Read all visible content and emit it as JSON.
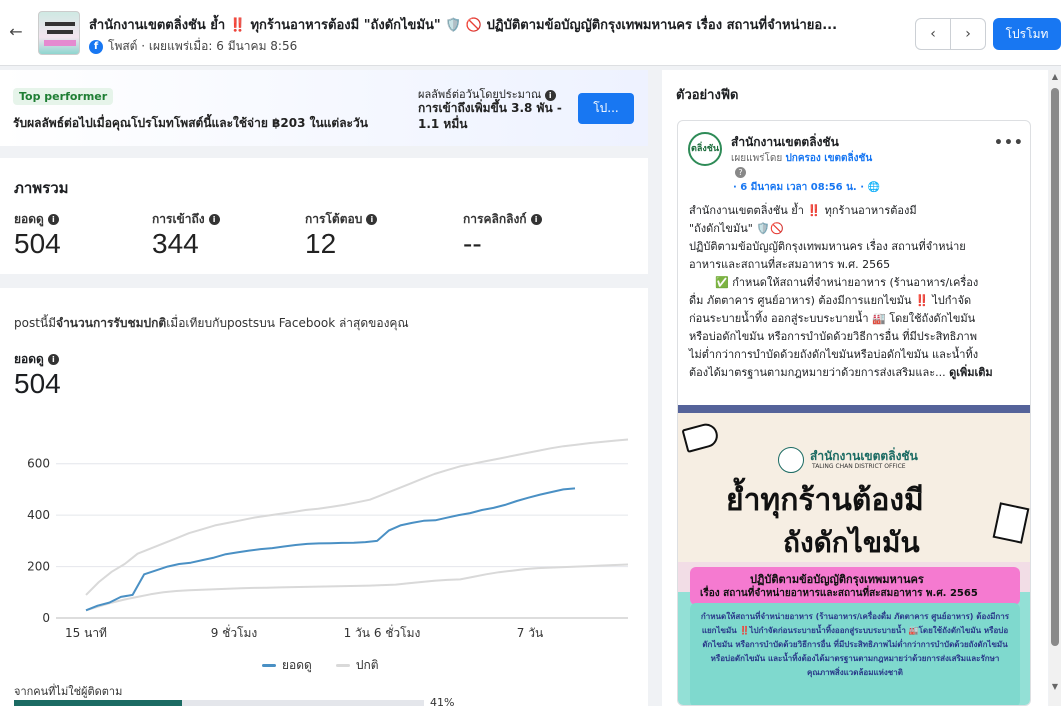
{
  "header": {
    "title": "สำนักงานเขตตลิ่งชัน ย้ำ ‼️ ทุกร้านอาหารต้องมี \"ถังดักไขมัน\" 🛡️ 🚫 ปฏิบัติตามข้อบัญญัติกรุงเทพมหานคร เรื่อง สถานที่จำหน่ายอ...",
    "meta": "โพสต์ · เผยแพร่เมื่อ: 6 มีนาคม 8:56",
    "promote_label": "โปรโมท",
    "back_icon": "←",
    "prev_icon": "‹",
    "next_icon": "›"
  },
  "top_performer": {
    "badge": "Top performer",
    "text": "รับผลลัพธ์ต่อไปเมื่อคุณโปรโมทโพสต์นี้และใช้จ่าย ฿203 ในแต่ละวัน",
    "result_label": "ผลลัพธ์ต่อวันโดยประมาณ",
    "result_value": "การเข้าถึงเพิ่มขึ้น 3.8 พัน - 1.1 หมื่น",
    "button_label": "โป..."
  },
  "overview": {
    "title": "ภาพรวม",
    "metrics": [
      {
        "label": "ยอดดู",
        "value": "504"
      },
      {
        "label": "การเข้าถึง",
        "value": "344"
      },
      {
        "label": "การโต้ตอบ",
        "value": "12"
      },
      {
        "label": "การคลิกลิงก์",
        "value": "--"
      }
    ]
  },
  "chart_panel": {
    "desc_pre": "postนี้มี",
    "desc_bold": "จำนวนการรับชมปกติ",
    "desc_post": "เมื่อเทียบกับpostsบน Facebook ล่าสุดของคุณ",
    "metric_label": "ยอดดู",
    "metric_value": "504",
    "non_follower_label": "จากคนที่ไม่ใช่ผู้ติดตาม",
    "non_follower_pct": "41%",
    "non_follower_fraction": 0.41
  },
  "chart_data": {
    "type": "line",
    "x_ticks": [
      "15 นาที",
      "9 ชั่วโมง",
      "1 วัน 6 ชั่วโมง",
      "7 วัน"
    ],
    "y_ticks": [
      0,
      200,
      400,
      600
    ],
    "ylim": [
      0,
      700
    ],
    "legend_position": "bottom",
    "series": [
      {
        "name": "ยอดดู",
        "color": "#4a90c4",
        "values": [
          30,
          48,
          60,
          82,
          90,
          170,
          185,
          200,
          210,
          215,
          225,
          235,
          248,
          255,
          262,
          268,
          272,
          278,
          284,
          288,
          290,
          291,
          292,
          293,
          295,
          300,
          340,
          360,
          370,
          378,
          380,
          390,
          400,
          408,
          420,
          428,
          440,
          455,
          468,
          480,
          490,
          500,
          504
        ]
      },
      {
        "name": "ปกติ",
        "color": "#d9d9d9",
        "values": [
          90,
          140,
          180,
          210,
          250,
          270,
          290,
          310,
          330,
          345,
          360,
          370,
          380,
          390,
          398,
          405,
          412,
          420,
          425,
          432,
          440,
          450,
          460,
          480,
          500,
          520,
          540,
          560,
          575,
          590,
          600,
          610,
          620,
          630,
          640,
          650,
          660,
          668,
          674,
          680,
          685,
          690,
          694
        ]
      },
      {
        "name": "",
        "color": "#d9d9d9",
        "values": [
          30,
          45,
          60,
          72,
          82,
          92,
          100,
          105,
          108,
          110,
          112,
          114,
          116,
          117,
          118,
          119,
          120,
          121,
          122,
          123,
          124,
          125,
          126,
          128,
          130,
          135,
          140,
          145,
          148,
          150,
          160,
          170,
          178,
          184,
          190,
          194,
          196,
          198,
          200,
          202,
          204,
          206,
          208
        ]
      }
    ]
  },
  "preview": {
    "title": "ตัวอย่างฟีด",
    "page_name": "สำนักงานเขตตลิ่งชัน",
    "avatar_text": "ตลิ่งชัน",
    "published_by_pre": "เผยแพร่โดย ",
    "published_by_name": "ปกครอง เขตตลิ่งชัน",
    "q_icon": "?",
    "post_time": "· 6 มีนาคม เวลา 08:56 น. · 🌐",
    "more_icon": "•••",
    "body_lines": [
      "สำนักงานเขตตลิ่งชัน ย้ำ ‼️ ทุกร้านอาหารต้องมี",
      "\"ถังดักไขมัน\" 🛡️🚫",
      "ปฏิบัติตามข้อบัญญัติกรุงเทพมหานคร เรื่อง สถานที่จำหน่าย",
      "อาหารและสถานที่สะสมอาหาร พ.ศ. 2565",
      "✅ กำหนดให้สถานที่จำหน่ายอาหาร (ร้านอาหาร/เครื่อง",
      "ดื่ม ภัตตาคาร ศูนย์อาหาร) ต้องมีการแยกไขมัน ‼️ ไปกำจัด",
      "ก่อนระบายน้ำทิ้ง ออกสู่ระบบระบายน้ำ 🏭 โดยใช้ถังดักไขมัน",
      "หรือบ่อดักไขมัน หรือการบำบัดด้วยวิธีการอื่น ที่มีประสิทธิภาพ",
      "ไม่ต่ำกว่าการบำบัดด้วยถังดักไขมันหรือบ่อดักไขมัน และน้ำทิ้ง",
      "ต้องได้มาตรฐานตามกฎหมายว่าด้วยการส่งเสริมและ..."
    ],
    "see_more": "ดูเพิ่มเติม",
    "image": {
      "office_th": "สำนักงานเขตตลิ่งชัน",
      "office_en": "TALING CHAN DISTRICT OFFICE",
      "headline1": "ย้ำทุกร้านต้องมี",
      "headline2": "ถังดักไขมัน",
      "pink1": "ปฏิบัติตามข้อบัญญัติกรุงเทพมหานคร",
      "pink2": "เรื่อง สถานที่จำหน่ายอาหารและสถานที่สะสมอาหาร พ.ศ. 2565",
      "small": "กำหนดให้สถานที่จำหน่ายอาหาร (ร้านอาหาร/เครื่องดื่ม ภัตตาคาร ศูนย์อาหาร) ต้องมีการแยกไขมัน ‼️ไปกำจัดก่อนระบายน้ำทิ้งออกสู่ระบบระบายน้ำ 🏭โดยใช้ถังดักไขมัน หรือบ่อดักไขมัน หรือการบำบัดด้วยวิธีการอื่น ที่มีประสิทธิภาพไม่ต่ำกว่าการบำบัดด้วยถังดักไขมันหรือบ่อดักไขมัน และน้ำทิ้งต้องได้มาตรฐานตามกฎหมายว่าด้วยการส่งเสริมและรักษาคุณภาพสิ่งแวดล้อมแห่งชาติ"
    }
  }
}
